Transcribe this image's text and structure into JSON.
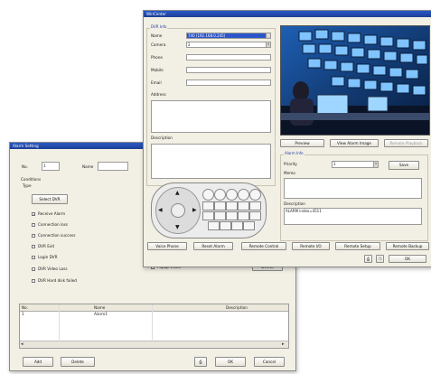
{
  "alarm_setting": {
    "title": "Alarm Setting",
    "no_label": "No.",
    "no_value": "1",
    "name_label": "Name",
    "name_value": "",
    "conditions_label": "Conditions",
    "type_label": "Type",
    "select_dvr_label": "Select DVR",
    "checkboxes": [
      {
        "label": "Receive Alarm",
        "checked": true
      },
      {
        "label": "Connection loss",
        "checked": false
      },
      {
        "label": "Connection success",
        "checked": false
      },
      {
        "label": "DVR Exit",
        "checked": false
      },
      {
        "label": "Login DVR",
        "checked": false
      },
      {
        "label": "DVR Video Loss",
        "checked": false
      },
      {
        "label": "DVR Hard disk failed",
        "checked": false
      }
    ],
    "popup_video_label": "Popup Video",
    "delete_small_label": "Delete",
    "table": {
      "headers": [
        "No.",
        "Name",
        "Description"
      ],
      "rows": [
        [
          "1",
          "Alarm1",
          ""
        ]
      ]
    },
    "buttons": {
      "add": "Add",
      "delete": "Delete",
      "ok": "OK",
      "cancel": "Cancel"
    }
  },
  "wincenter": {
    "title": "WinCenter",
    "dvr_info_label": "DVR Info",
    "fields": {
      "name_label": "Name",
      "name_value": "740 (192.168.0.245)",
      "camera_label": "Camera",
      "camera_value": "2",
      "phone_label": "Phone",
      "mobile_label": "Mobile",
      "email_label": "Email",
      "address_label": "Address",
      "description_label": "Description"
    },
    "preview_buttons": {
      "preview": "Preview",
      "view_alarm_image": "View Alarm Image",
      "remote_playback": "Remote Playback"
    },
    "alarm_info": {
      "label": "Alarm Info",
      "priority_label": "Priority",
      "priority_value": "1",
      "save_label": "Save",
      "memo_label": "Memo",
      "description_label": "Description",
      "description_value": "ALARM index=4511"
    },
    "bottom_buttons": [
      "Voice Phone",
      "Reset Alarm",
      "Remote Control",
      "Remote I/O",
      "Remote Setup",
      "Remote Backup"
    ],
    "ok_label": "OK"
  },
  "colors": {
    "titlebar": "#2a5ac8",
    "window_bg": "#f2efe4",
    "selection": "#2b55c8"
  }
}
